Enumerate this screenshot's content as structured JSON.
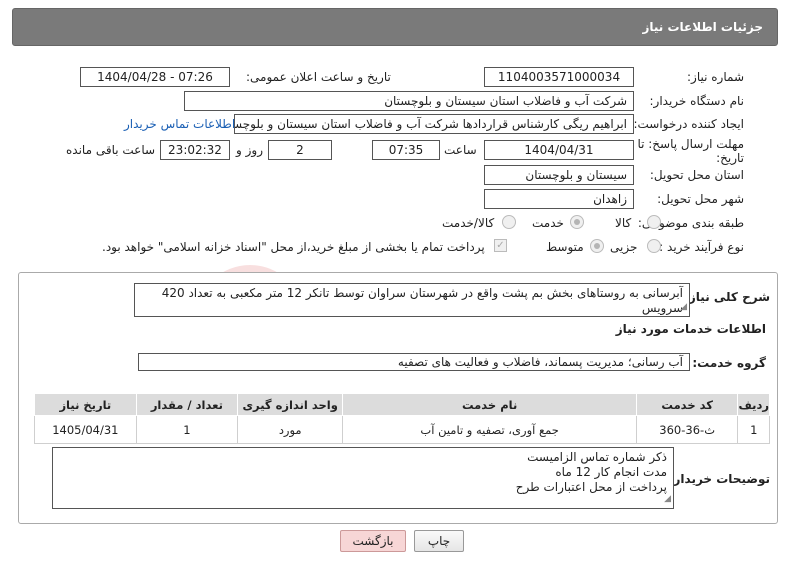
{
  "header": {
    "title": "جزئیات اطلاعات نیاز"
  },
  "fields": {
    "need_number_label": "شماره نیاز:",
    "need_number": "1104003571000034",
    "announce_label": "تاریخ و ساعت اعلان عمومی:",
    "announce_value": "1404/04/28 - 07:26",
    "buyer_org_label": "نام دستگاه خریدار:",
    "buyer_org": "شرکت آب و فاضلاب استان سیستان و بلوچستان",
    "creator_label": "ایجاد کننده درخواست:",
    "creator": "ابراهیم ریگی کارشناس قراردادها شرکت آب و فاضلاب استان سیستان و بلوچستان",
    "contact_link": "اطلاعات تماس خریدار",
    "deadline_label": "مهلت ارسال پاسخ: تا تاریخ:",
    "deadline_date": "1404/04/31",
    "time_label": "ساعت",
    "deadline_time": "07:35",
    "days_value": "2",
    "days_label": "روز و",
    "remaining_time": "23:02:32",
    "remaining_label": "ساعت باقی مانده",
    "province_label": "استان محل تحویل:",
    "province": "سیستان و بلوچستان",
    "city_label": "شهر محل تحویل:",
    "city": "زاهدان",
    "category_label": "طبقه بندی موضوعی:",
    "category_options": [
      "کالا",
      "خدمت",
      "کالا/خدمت"
    ],
    "process_label": "نوع فرآیند خرید :",
    "process_options": [
      "جزیی",
      "متوسط"
    ],
    "payment_note": "پرداخت تمام یا بخشی از مبلغ خرید،از محل \"اسناد خزانه اسلامی\" خواهد بود."
  },
  "summary": {
    "label": "شرح کلی نیاز:",
    "text": "آبرسانی به روستاهای بخش بم پشت واقع در شهرستان سراوان  توسط تانکر 12 متر مکعبی به تعداد 420 سرویس"
  },
  "services": {
    "section_title": "اطلاعات خدمات مورد نیاز",
    "group_label": "گروه خدمت:",
    "group_value": "آب رسانی؛ مدیریت پسماند، فاضلاب و فعالیت های تصفیه",
    "columns": [
      "ردیف",
      "کد خدمت",
      "نام خدمت",
      "واحد اندازه گیری",
      "تعداد / مقدار",
      "تاریخ نیاز"
    ],
    "rows": [
      {
        "row": "1",
        "code": "ث-36-360",
        "name": "جمع آوری، تصفیه و تامین آب",
        "unit": "مورد",
        "qty": "1",
        "date": "1405/04/31"
      }
    ]
  },
  "notes": {
    "label": "توضیحات خریدار:",
    "lines": [
      "ذکر شماره تماس الزامیست",
      "مدت انجام کار  12 ماه",
      "پرداخت از محل اعتبارات طرح"
    ]
  },
  "buttons": {
    "print": "چاپ",
    "back": "بازگشت"
  },
  "colors": {
    "header_bg": "#7a7a7a",
    "link": "#1a5fb4",
    "table_header": "#dcdcdc",
    "back_button": "#f7d6d6"
  }
}
